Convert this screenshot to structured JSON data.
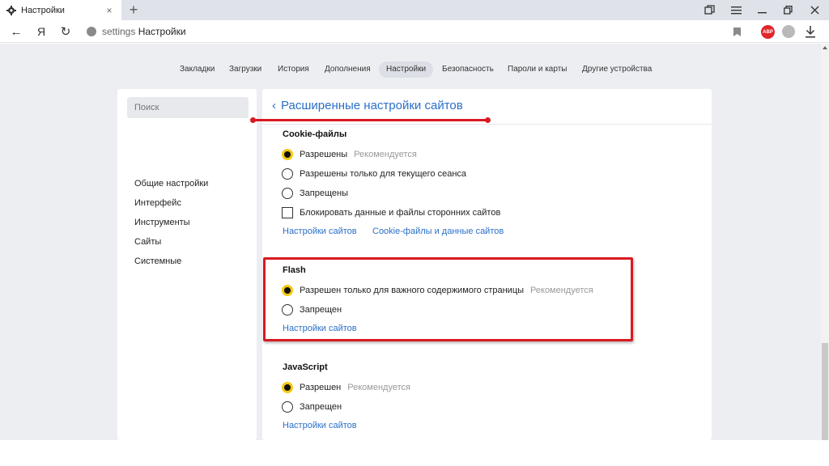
{
  "tab": {
    "title": "Настройки",
    "close_glyph": "×",
    "new_tab_glyph": "+",
    "icon": "gear-icon"
  },
  "navbar": {
    "back_glyph": "←",
    "yandex_glyph": "Я",
    "reload_glyph": "↻",
    "url_scheme": "settings",
    "url_title": "Настройки",
    "abp_label": "ABP"
  },
  "top_nav": {
    "items": [
      "Закладки",
      "Загрузки",
      "История",
      "Дополнения",
      "Настройки",
      "Безопасность",
      "Пароли и карты",
      "Другие устройства"
    ],
    "active": "Настройки"
  },
  "sidebar": {
    "search_placeholder": "Поиск",
    "items": [
      "Общие настройки",
      "Интерфейс",
      "Инструменты",
      "Сайты",
      "Системные"
    ]
  },
  "content": {
    "back_glyph": "‹",
    "title": "Расширенные настройки сайтов",
    "cookies": {
      "title": "Cookie-файлы",
      "options": [
        {
          "label": "Разрешены",
          "hint": "Рекомендуется",
          "checked": true
        },
        {
          "label": "Разрешены только для текущего сеанса",
          "hint": "",
          "checked": false
        },
        {
          "label": "Запрещены",
          "hint": "",
          "checked": false
        }
      ],
      "checkbox_label": "Блокировать данные и файлы сторонних сайтов",
      "link_site_settings": "Настройки сайтов",
      "link_cookie_data": "Cookie-файлы и данные сайтов"
    },
    "flash": {
      "title": "Flash",
      "options": [
        {
          "label": "Разрешен только для важного содержимого страницы",
          "hint": "Рекомендуется",
          "checked": true
        },
        {
          "label": "Запрещен",
          "hint": "",
          "checked": false
        }
      ],
      "link_site_settings": "Настройки сайтов"
    },
    "javascript": {
      "title": "JavaScript",
      "options": [
        {
          "label": "Разрешен",
          "hint": "Рекомендуется",
          "checked": true
        },
        {
          "label": "Запрещен",
          "hint": "",
          "checked": false
        }
      ],
      "link_site_settings": "Настройки сайтов"
    }
  },
  "colors": {
    "accent": "#2a6fc9",
    "annotation_red": "#d91a22",
    "radio_yellow": "#f6c90f",
    "page_bg": "#eceef2"
  }
}
